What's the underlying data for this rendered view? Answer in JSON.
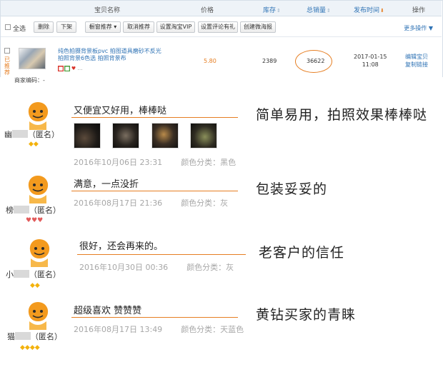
{
  "table": {
    "headers": {
      "name": "宝贝名称",
      "price": "价格",
      "stock": "库存",
      "sales": "总销量",
      "date": "发布时间",
      "ops": "操作"
    },
    "toolbar": {
      "select_all": "全选",
      "delete": "删除",
      "delist": "下架",
      "window_rec": "橱窗推荐",
      "cancel_rec": "取消推荐",
      "vip": "设置淘宝VIP",
      "review_gift": "设置评论有礼",
      "poster": "创建微海报",
      "more_ops": "更多操作 ▼"
    },
    "item": {
      "recommended": "已推荐",
      "merchant_code": "商家编码：-",
      "title_1": "纯色拍摄背景板pvc 拍图道具磨砂不反光",
      "title_2": "拍照背景6色选 拍照背景布",
      "price": "5.80",
      "stock": "2389",
      "sales": "36622",
      "date": "2017-01-15",
      "time": "11:08",
      "edit": "编辑宝贝",
      "copy": "复制链接"
    }
  },
  "reviews": [
    {
      "user_suffix": "（匿名）",
      "user_prefix": "幽",
      "rank": "◆◆",
      "rank_style": "diamond",
      "text": "又便宜又好用，棒棒哒",
      "date": "2016年10月06日 23:31",
      "spec": "颜色分类：黑色",
      "caption": "简单易用，拍照效果棒棒哒"
    },
    {
      "user_suffix": "（匿名）",
      "user_prefix": "榜",
      "rank": "♥♥♥",
      "rank_style": "heart",
      "text": "满意，一点没折",
      "date": "2016年08月17日 21:36",
      "spec": "颜色分类：灰",
      "caption": "包装妥妥的"
    },
    {
      "user_suffix": "（匿名）",
      "user_prefix": "小",
      "rank": "◆◆",
      "rank_style": "diamond",
      "text": "很好，还会再来的。",
      "date": "2016年10月30日 00:36",
      "spec": "颜色分类：灰",
      "caption": "老客户的信任"
    },
    {
      "user_suffix": "（匿名）",
      "user_prefix": "猫",
      "rank": "◆◆◆◆",
      "rank_style": "diamond",
      "text": "超级喜欢 赞赞赞",
      "date": "2016年08月17日 13:49",
      "spec": "颜色分类：天蓝色",
      "caption": "黄钻买家的青睐"
    }
  ],
  "colors": {
    "accent": "#e67e22",
    "link": "#2f73b5",
    "header_bg": "#eef3f8",
    "meta_gray": "#a7a7a7"
  }
}
